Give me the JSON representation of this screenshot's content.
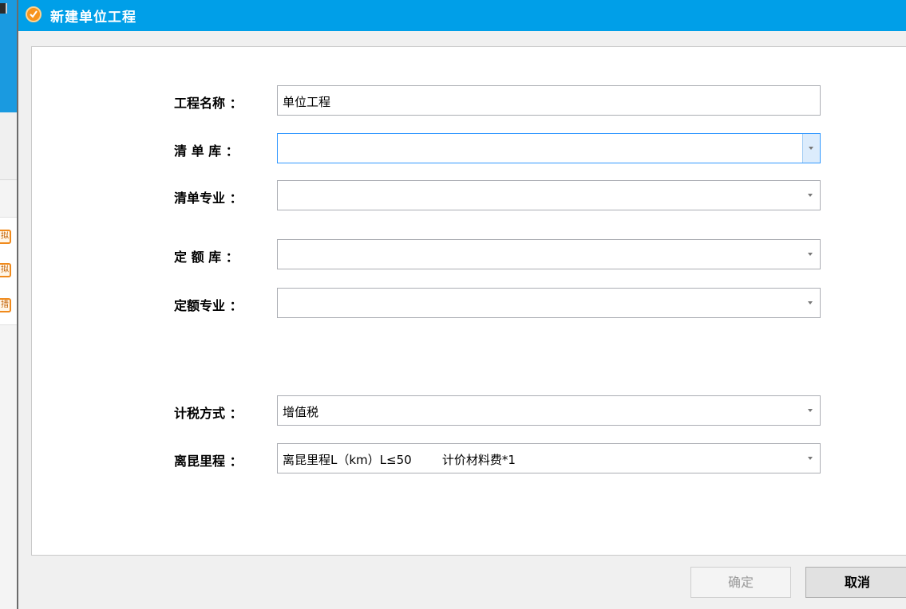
{
  "background_app": {
    "list_item_glyphs": [
      "拟",
      "拟",
      "措"
    ]
  },
  "dialog": {
    "title": "新建单位工程",
    "accent_color": "#009fe8",
    "fields": [
      {
        "label": "工程名称 ：",
        "value": "单位工程",
        "type": "text"
      },
      {
        "label": "清 单 库 ：",
        "value": "",
        "type": "dropdown",
        "active": true
      },
      {
        "label": "清单专业 ：",
        "value": "",
        "type": "dropdown"
      },
      {
        "label": "定 额 库 ：",
        "value": "",
        "type": "dropdown"
      },
      {
        "label": "定额专业 ：",
        "value": "",
        "type": "dropdown"
      },
      {
        "label": "计税方式 ：",
        "value": "增值税",
        "type": "dropdown"
      },
      {
        "label": "离昆里程 ：",
        "value": "离昆里程L（km）L≤50        计价材料费*1",
        "type": "dropdown"
      }
    ],
    "buttons": {
      "ok": "确定",
      "cancel": "取消"
    }
  }
}
